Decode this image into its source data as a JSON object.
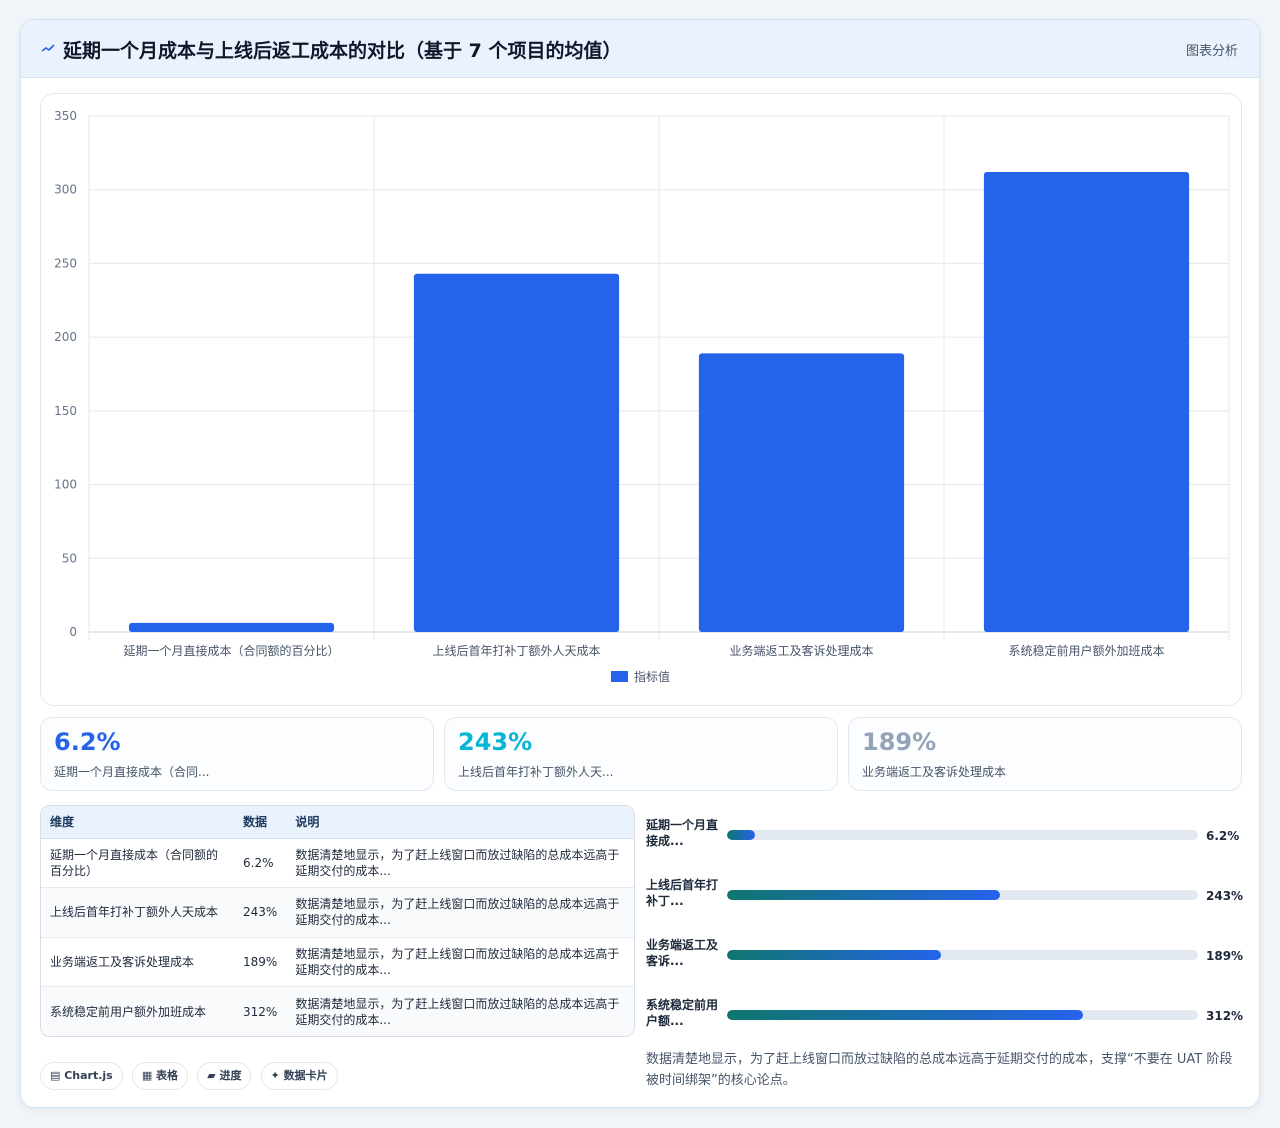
{
  "header": {
    "icon": "wave-icon",
    "title": "延期一个月成本与上线后返工成本的对比（基于 7 个项目的均值）",
    "subtitle": "图表分析"
  },
  "chart_data": {
    "type": "bar",
    "categories": [
      "延期一个月直接成本（合同额的百分比）",
      "上线后首年打补丁额外人天成本",
      "业务端返工及客诉处理成本",
      "系统稳定前用户额外加班成本"
    ],
    "series": [
      {
        "name": "指标值",
        "values": [
          6.2,
          243,
          189,
          312
        ],
        "color": "#2563eb"
      }
    ],
    "yticks": [
      "0",
      "50",
      "100",
      "150",
      "200",
      "250",
      "300",
      "350"
    ],
    "ylim": [
      0,
      350
    ],
    "grid": true,
    "legend": "bottom"
  },
  "stats": [
    {
      "value": "6.2%",
      "label": "延期一个月直接成本（合同...",
      "color": "#2563eb"
    },
    {
      "value": "243%",
      "label": "上线后首年打补丁额外人天...",
      "color": "#06b6d4"
    },
    {
      "value": "189%",
      "label": "业务端返工及客诉处理成本",
      "color": "#94a3b8"
    }
  ],
  "table": {
    "headers": [
      "维度",
      "数据",
      "说明"
    ],
    "rows": [
      [
        "延期一个月直接成本（合同额的百分比）",
        "6.2%",
        "数据清楚地显示，为了赶上线窗口而放过缺陷的总成本远高于延期交付的成本..."
      ],
      [
        "上线后首年打补丁额外人天成本",
        "243%",
        "数据清楚地显示，为了赶上线窗口而放过缺陷的总成本远高于延期交付的成本..."
      ],
      [
        "业务端返工及客诉处理成本",
        "189%",
        "数据清楚地显示，为了赶上线窗口而放过缺陷的总成本远高于延期交付的成本..."
      ],
      [
        "系统稳定前用户额外加班成本",
        "312%",
        "数据清楚地显示，为了赶上线窗口而放过缺陷的总成本远高于延期交付的成本..."
      ]
    ]
  },
  "progress": [
    {
      "label": "延期一个月直接成...",
      "value": "6.2%",
      "fraction": 0.06
    },
    {
      "label": "上线后首年打补丁...",
      "value": "243%",
      "fraction": 0.58
    },
    {
      "label": "业务端返工及客诉...",
      "value": "189%",
      "fraction": 0.455
    },
    {
      "label": "系统稳定前用户额...",
      "value": "312%",
      "fraction": 0.755
    }
  ],
  "note": "数据清楚地显示，为了赶上线窗口而放过缺陷的总成本远高于延期交付的成本，支撑“不要在 UAT 阶段被时间绑架”的核心论点。",
  "tags": [
    "▤ Chart.js",
    "▦ 表格",
    "▰ 进度",
    "✦ 数据卡片"
  ]
}
